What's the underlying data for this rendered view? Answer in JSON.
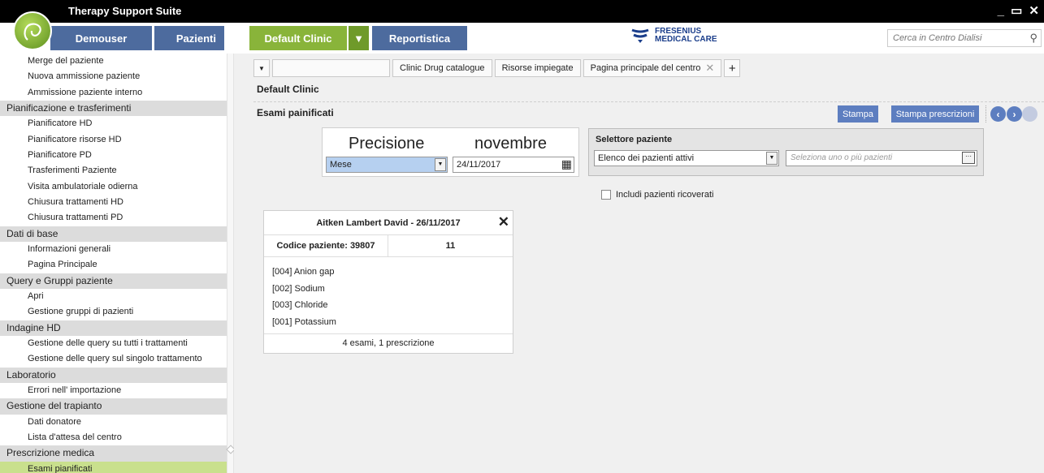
{
  "app": {
    "title": "Therapy Support Suite",
    "window_controls": "_ ▭ ✕"
  },
  "menu": {
    "user": "Demouser",
    "patients": "Pazienti",
    "clinic": "Default Clinic",
    "clinic_arrow": "▼",
    "reports": "Reportistica",
    "brand_line1": "FRESENIUS",
    "brand_line2": "MEDICAL CARE",
    "search_placeholder": "Cerca in Centro Dialisi"
  },
  "sidebar": {
    "items": [
      {
        "type": "item",
        "label": "Merge del paziente"
      },
      {
        "type": "item",
        "label": "Nuova ammissione paziente"
      },
      {
        "type": "item",
        "label": "Ammissione paziente interno"
      },
      {
        "type": "header",
        "label": "Pianificazione e trasferimenti"
      },
      {
        "type": "item",
        "label": "Pianificatore HD"
      },
      {
        "type": "item",
        "label": "Pianificatore risorse HD"
      },
      {
        "type": "item",
        "label": "Pianificatore PD"
      },
      {
        "type": "item",
        "label": "Trasferimenti Paziente"
      },
      {
        "type": "item",
        "label": "Visita ambulatoriale odierna"
      },
      {
        "type": "item",
        "label": "Chiusura trattamenti HD"
      },
      {
        "type": "item",
        "label": "Chiusura trattamenti PD"
      },
      {
        "type": "header",
        "label": "Dati di base"
      },
      {
        "type": "item",
        "label": "Informazioni generali"
      },
      {
        "type": "item",
        "label": "Pagina Principale"
      },
      {
        "type": "header",
        "label": "Query e Gruppi paziente"
      },
      {
        "type": "item",
        "label": "Apri"
      },
      {
        "type": "item",
        "label": "Gestione gruppi di pazienti"
      },
      {
        "type": "header",
        "label": "Indagine HD"
      },
      {
        "type": "item",
        "label": "Gestione delle query su tutti i trattamenti"
      },
      {
        "type": "item",
        "label": "Gestione delle query sul singolo trattamento"
      },
      {
        "type": "header",
        "label": "Laboratorio"
      },
      {
        "type": "item",
        "label": "Errori nell' importazione"
      },
      {
        "type": "header",
        "label": "Gestione del trapianto"
      },
      {
        "type": "item",
        "label": "Dati donatore"
      },
      {
        "type": "item",
        "label": "Lista d'attesa del centro"
      },
      {
        "type": "header",
        "label": "Prescrizione medica"
      },
      {
        "type": "item",
        "label": "Esami pianificati",
        "active": true
      }
    ]
  },
  "tabs": [
    "Clinic Drug catalogue",
    "Risorse impiegate",
    "Pagina principale del centro"
  ],
  "page": {
    "title": "Default Clinic",
    "section": "Esami painificati",
    "print": "Stampa",
    "print_prescriptions": "Stampa prescrizioni"
  },
  "precision": {
    "label": "Precisione",
    "month_name": "novembre",
    "unit": "Mese",
    "date": "24/11/2017"
  },
  "patient_selector": {
    "label": "Selettore paziente",
    "list": "Elenco dei pazienti attivi",
    "placeholder": "Seleziona uno o più pazienti",
    "include_label": "Includi pazienti ricoverati"
  },
  "card": {
    "title": "Aitken Lambert David - 26/11/2017",
    "code_label": "Codice paziente:",
    "code": "39807",
    "count": "11",
    "exams": [
      "[004] Anion gap",
      "[002] Sodium",
      "[003] Chloride",
      "[001] Potassium"
    ],
    "footer": "4 esami, 1 prescrizione"
  }
}
